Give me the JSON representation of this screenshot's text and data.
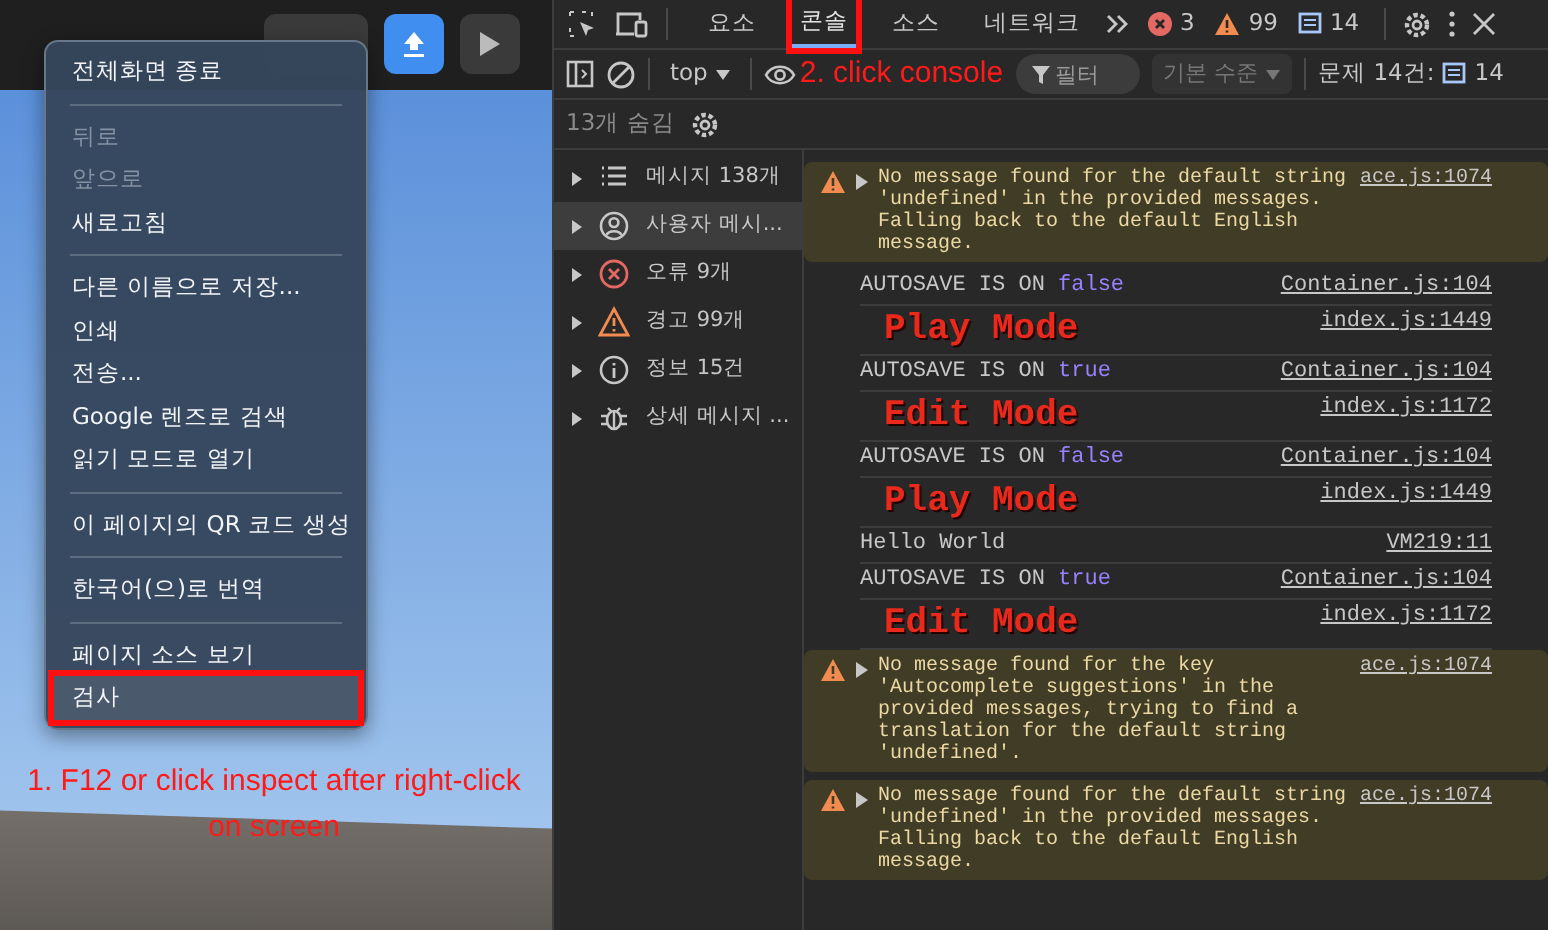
{
  "context_menu": {
    "sections": [
      [
        {
          "label": "전체화면 종료",
          "disabled": false,
          "selected": false,
          "annotated": false
        }
      ],
      [
        {
          "label": "뒤로",
          "disabled": true,
          "selected": false,
          "annotated": false
        },
        {
          "label": "앞으로",
          "disabled": true,
          "selected": false,
          "annotated": false
        },
        {
          "label": "새로고침",
          "disabled": false,
          "selected": false,
          "annotated": false
        }
      ],
      [
        {
          "label": "다른 이름으로 저장...",
          "disabled": false,
          "selected": false,
          "annotated": false
        },
        {
          "label": "인쇄",
          "disabled": false,
          "selected": false,
          "annotated": false
        },
        {
          "label": "전송...",
          "disabled": false,
          "selected": false,
          "annotated": false
        },
        {
          "label": "Google 렌즈로 검색",
          "disabled": false,
          "selected": false,
          "annotated": false
        },
        {
          "label": "읽기 모드로 열기",
          "disabled": false,
          "selected": false,
          "annotated": false
        }
      ],
      [
        {
          "label": "이 페이지의 QR 코드 생성",
          "disabled": false,
          "selected": false,
          "annotated": false
        }
      ],
      [
        {
          "label": "한국어(으)로 번역",
          "disabled": false,
          "selected": false,
          "annotated": false
        }
      ],
      [
        {
          "label": "페이지 소스 보기",
          "disabled": false,
          "selected": false,
          "annotated": false
        },
        {
          "label": "검사",
          "disabled": false,
          "selected": true,
          "annotated": true
        }
      ]
    ]
  },
  "annotations": [
    {
      "text": "1. F12 or click inspect after right-click on screen"
    },
    {
      "text": "2. click console"
    }
  ],
  "devtools": {
    "tabs": [
      {
        "label": "요소",
        "selected": false,
        "annotated": false
      },
      {
        "label": "콘솔",
        "selected": true,
        "annotated": true
      },
      {
        "label": "소스",
        "selected": false,
        "annotated": false
      },
      {
        "label": "네트워크",
        "selected": false,
        "annotated": false
      }
    ],
    "counts": {
      "errors": "3",
      "warnings": "99",
      "messages": "14"
    },
    "console_toolbar": {
      "context": "top",
      "filter_placeholder": "필터",
      "level": "기본 수준",
      "issues_label": "문제 14건:",
      "issues_count": "14"
    },
    "hidden_label": "13개 숨김",
    "sidebar": [
      {
        "label": "메시지 138개",
        "kind": "list",
        "selected": false
      },
      {
        "label": "사용자 메시...",
        "kind": "user",
        "selected": true
      },
      {
        "label": "오류 9개",
        "kind": "error",
        "selected": false
      },
      {
        "label": "경고 99개",
        "kind": "warning",
        "selected": false
      },
      {
        "label": "정보 15건",
        "kind": "info",
        "selected": false
      },
      {
        "label": "상세 메시지 ...",
        "kind": "verbose",
        "selected": false
      }
    ],
    "messages": [
      {
        "kind": "warning",
        "text": "No message found for the default string 'undefined' in the provided messages. Falling back to the default English message.",
        "source": "ace.js:1074"
      },
      {
        "kind": "log",
        "text": "AUTOSAVE IS ON",
        "value": "false",
        "source": "Container.js:104"
      },
      {
        "kind": "styled",
        "text": "Play Mode",
        "source": "index.js:1449"
      },
      {
        "kind": "log",
        "text": "AUTOSAVE IS ON",
        "value": "true",
        "source": "Container.js:104"
      },
      {
        "kind": "styled",
        "text": "Edit Mode",
        "source": "index.js:1172"
      },
      {
        "kind": "log",
        "text": "AUTOSAVE IS ON",
        "value": "false",
        "source": "Container.js:104"
      },
      {
        "kind": "styled",
        "text": "Play Mode",
        "source": "index.js:1449"
      },
      {
        "kind": "log",
        "text": "Hello World",
        "source": "VM219:11"
      },
      {
        "kind": "log",
        "text": "AUTOSAVE IS ON",
        "value": "true",
        "source": "Container.js:104"
      },
      {
        "kind": "styled",
        "text": "Edit Mode",
        "source": "index.js:1172"
      },
      {
        "kind": "warning",
        "text": "No message found for the key 'Autocomplete suggestions' in the provided messages, trying to find a translation for the default string 'undefined'.",
        "source": "ace.js:1074"
      },
      {
        "kind": "warning",
        "text": "No message found for the default string 'undefined' in the provided messages. Falling back to the default English message.",
        "source": "ace.js:1074"
      }
    ]
  }
}
